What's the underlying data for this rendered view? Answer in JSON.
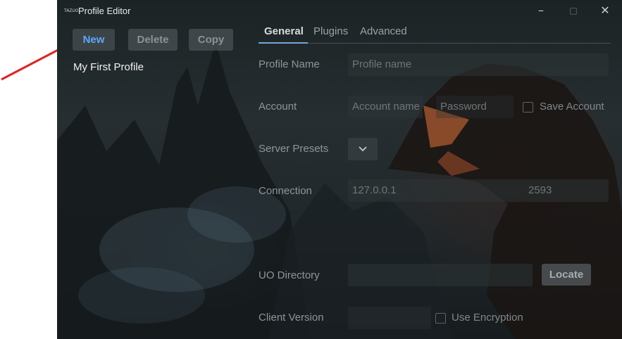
{
  "window": {
    "title": "Profile Editor",
    "app_icon_text": "TAZUO"
  },
  "profile_actions": {
    "new_label": "New",
    "delete_label": "Delete",
    "copy_label": "Copy"
  },
  "profiles": [
    "My First Profile"
  ],
  "tabs": [
    "General",
    "Plugins",
    "Advanced"
  ],
  "form": {
    "profile_name": {
      "label": "Profile Name",
      "placeholder": "Profile name"
    },
    "account": {
      "label": "Account",
      "account_placeholder": "Account name",
      "password_placeholder": "Password",
      "save_label": "Save Account"
    },
    "server_presets": {
      "label": "Server Presets"
    },
    "connection": {
      "label": "Connection",
      "ip": "127.0.0.1",
      "port": "2593"
    },
    "uo_directory": {
      "label": "UO Directory",
      "value": "",
      "locate_label": "Locate"
    },
    "client_version": {
      "label": "Client Version",
      "value": "",
      "encryption_label": "Use Encryption"
    }
  },
  "colors": {
    "accent": "#59a8ff",
    "arrow": "#e02424",
    "active_tab_underline": "#6fa8dc"
  },
  "icons": [
    "close-icon",
    "maximize-icon",
    "minimize-icon",
    "chevron-down-icon"
  ]
}
